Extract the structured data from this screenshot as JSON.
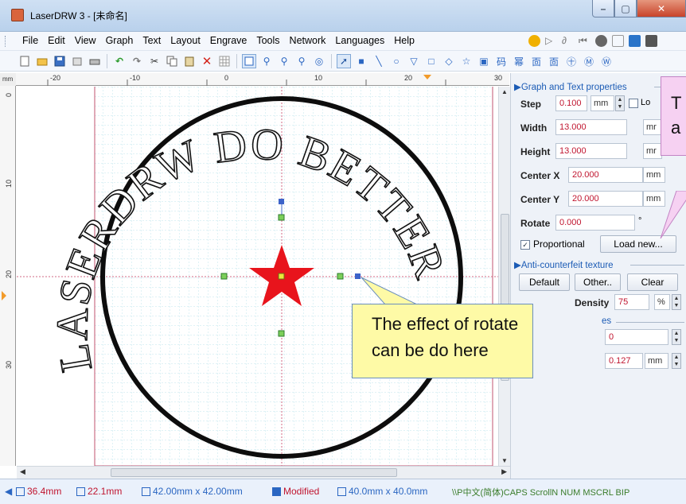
{
  "window": {
    "title": "LaserDRW 3 - [未命名]"
  },
  "menu": [
    "File",
    "Edit",
    "View",
    "Graph",
    "Text",
    "Layout",
    "Engrave",
    "Tools",
    "Network",
    "Languages",
    "Help"
  ],
  "ruler": {
    "unit": "mm",
    "h_ticks": [
      "-20",
      "-10",
      "0",
      "10",
      "20",
      "30"
    ],
    "v_ticks": [
      "0",
      "10",
      "20",
      "30"
    ]
  },
  "stamp": {
    "arc_text": "LASERDRW DO BETTER FOR"
  },
  "panel": {
    "graph_section": "Graph and Text properties",
    "step_label": "Step",
    "step_value": "0.100",
    "step_unit": "mm",
    "lock_label": "Lo",
    "width_label": "Width",
    "width_value": "13.000",
    "width_unit": "mr",
    "height_label": "Height",
    "height_value": "13.000",
    "height_unit": "mr",
    "centerx_label": "Center X",
    "centerx_value": "20.000",
    "centerx_unit": "mm",
    "centery_label": "Center Y",
    "centery_value": "20.000",
    "centery_unit": "mm",
    "rotate_label": "Rotate",
    "rotate_value": "0.000",
    "rotate_unit": "°",
    "proportional_label": "Proportional",
    "load_new_label": "Load new...",
    "anti_section": "Anti-counterfeit texture",
    "default_label": "Default",
    "other_label": "Other..",
    "clear_label": "Clear",
    "density_label": "Density",
    "density_value": "75",
    "density_unit": "%",
    "partial_label": "es",
    "partial_value_1": "0",
    "partial_value_2": "0.127",
    "partial_unit": "mm"
  },
  "status": {
    "x": "36.4mm",
    "y": "22.1mm",
    "size": "42.00mm x 42.00mm",
    "modified": "Modified",
    "size2": "40.0mm x 40.0mm",
    "tail": "\\\\P中文(简体)CAPS ScrollN NUM MSCRL BIP"
  },
  "callouts": {
    "main_line1": "The effect of rotate",
    "main_line2": "can be do here",
    "pink_line1": "T",
    "pink_line2": "a"
  },
  "colors": {
    "star": "#e8141c",
    "grid": "#bfe6ec",
    "callout": "#fefaa6",
    "pink_callout": "#f6d1f2"
  }
}
